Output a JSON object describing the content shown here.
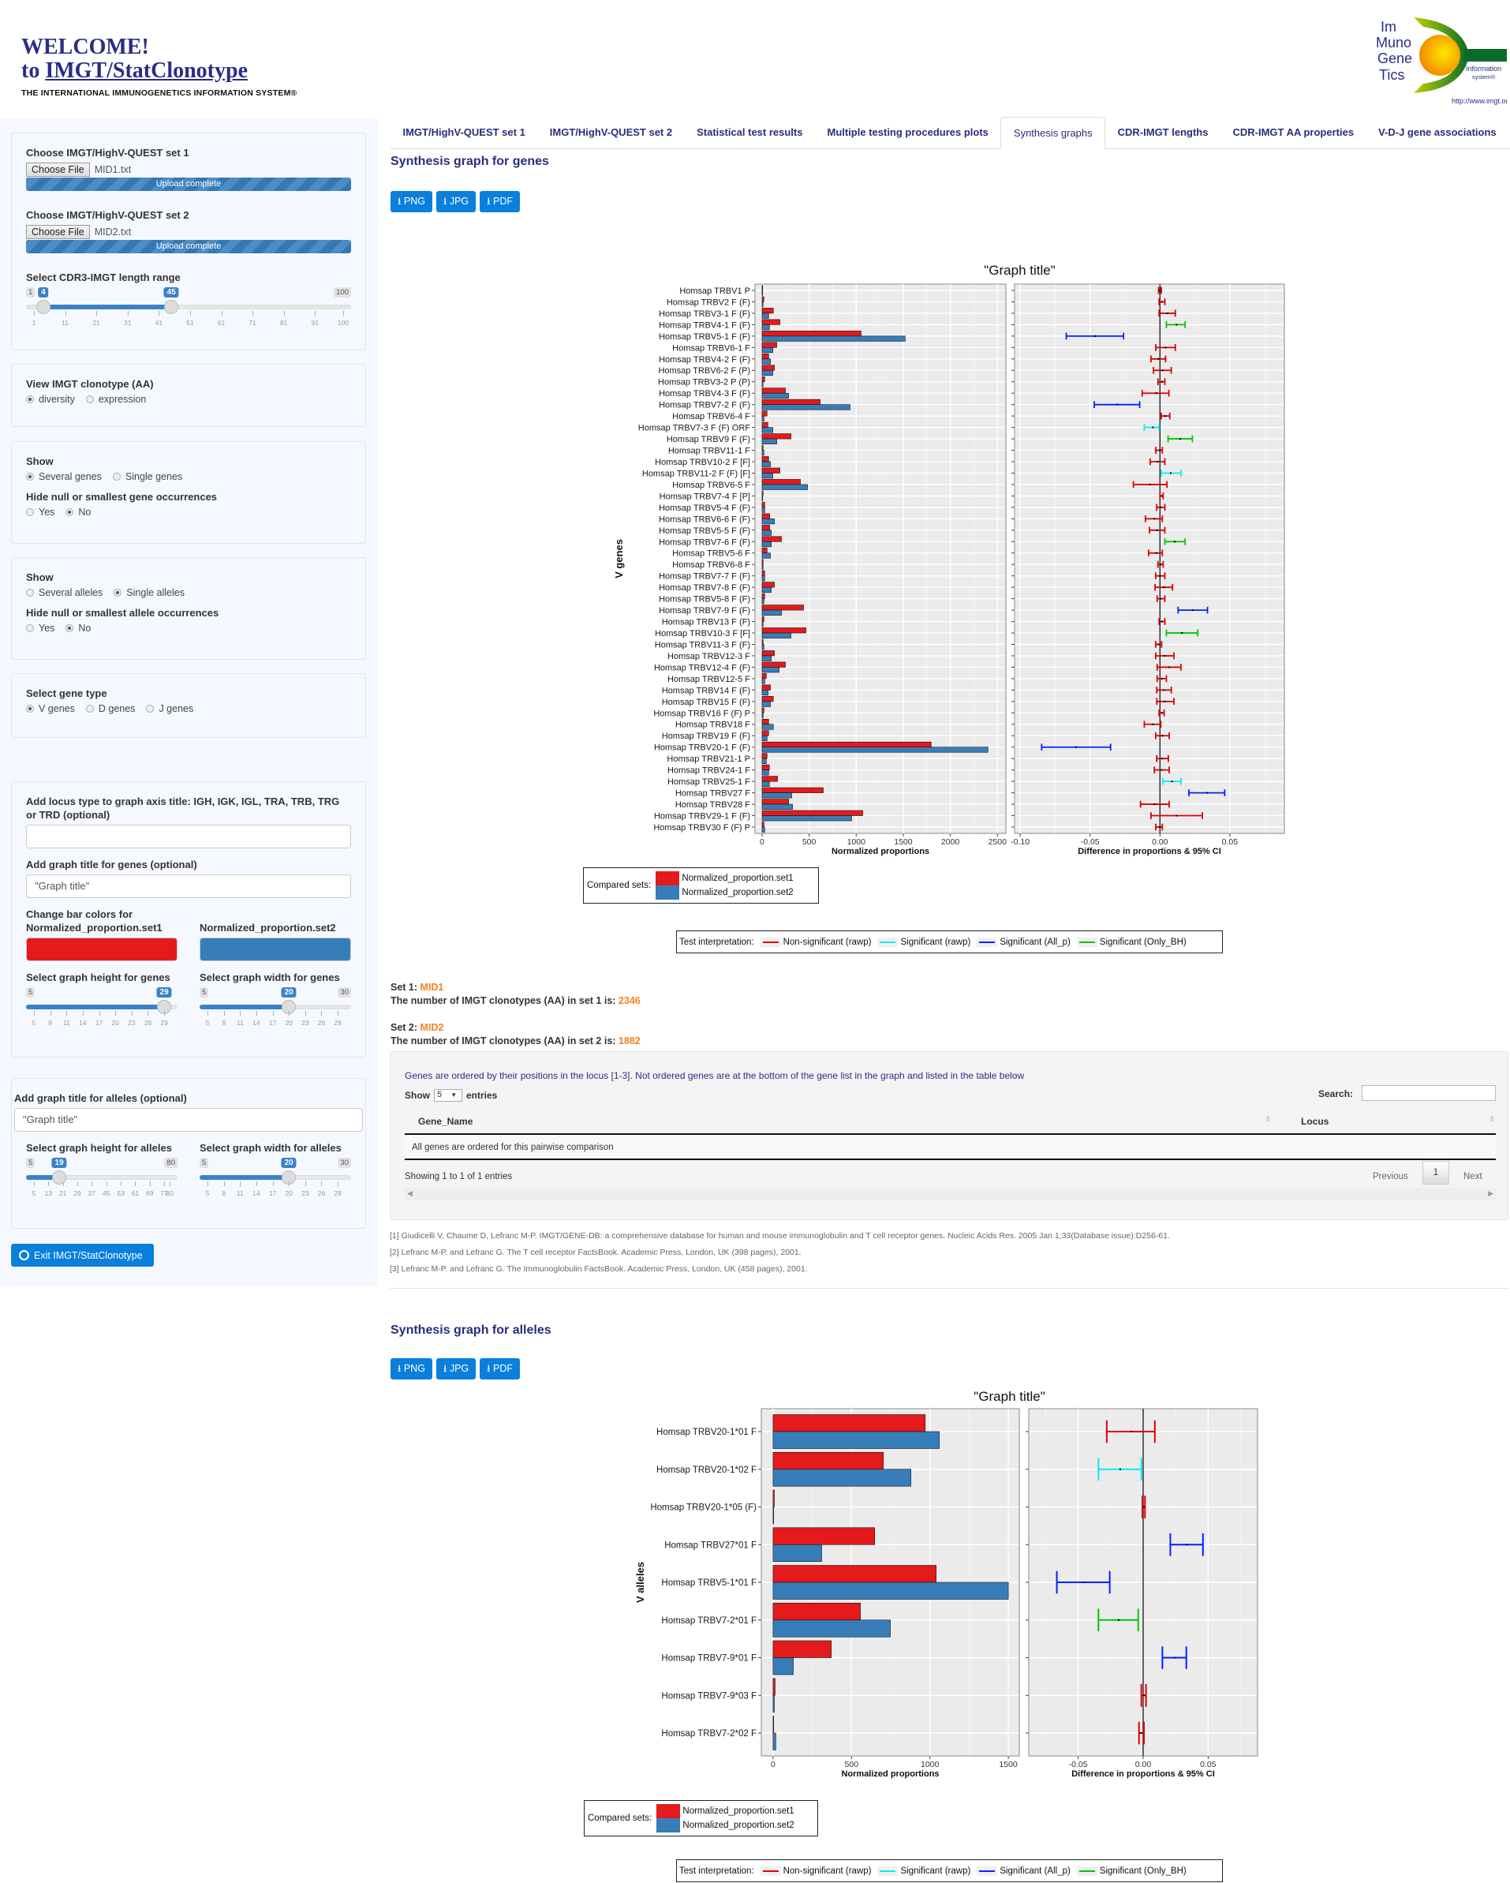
{
  "header": {
    "welcome": "WELCOME!",
    "to": "to",
    "app_link": "IMGT/StatClonotype",
    "subtitle": "THE INTERNATIONAL IMMUNOGENETICS INFORMATION SYSTEM®",
    "logo": {
      "lines": [
        "Im",
        "Muno",
        "Gene",
        "Tics"
      ],
      "info1": "Information",
      "info2": "system®",
      "url": "http://www.imgt.org"
    }
  },
  "sidebar": {
    "set1_label": "Choose IMGT/HighV-QUEST set 1",
    "set1_button": "Choose File",
    "set1_file": "MID1.txt",
    "set1_status": "Upload complete",
    "set2_label": "Choose IMGT/HighV-QUEST set 2",
    "set2_button": "Choose File",
    "set2_file": "MID2.txt",
    "set2_status": "Upload complete",
    "cdr3_label": "Select CDR3-IMGT length range",
    "cdr3_slider": {
      "min": 1,
      "max": 100,
      "from": 4,
      "to": 45,
      "ticks": [
        "1",
        "11",
        "21",
        "31",
        "41",
        "51",
        "61",
        "71",
        "81",
        "91",
        "100"
      ]
    },
    "view_label": "View IMGT clonotype (AA)",
    "view_options": [
      "diversity",
      "expression"
    ],
    "view_selected": 0,
    "show_genes_label": "Show",
    "show_genes_options": [
      "Several genes",
      "Single genes"
    ],
    "show_genes_selected": 0,
    "hide_gene_label": "Hide null or smallest gene occurrences",
    "hide_gene_options": [
      "Yes",
      "No"
    ],
    "hide_gene_selected": 1,
    "show_alleles_label": "Show",
    "show_alleles_options": [
      "Several alleles",
      "Single alleles"
    ],
    "show_alleles_selected": 1,
    "hide_allele_label": "Hide null or smallest allele occurrences",
    "hide_allele_options": [
      "Yes",
      "No"
    ],
    "hide_allele_selected": 1,
    "gene_type_label": "Select gene type",
    "gene_type_options": [
      "V genes",
      "D genes",
      "J genes"
    ],
    "gene_type_selected": 0,
    "locus_label": "Add locus type to graph axis title: IGH, IGK, IGL, TRA, TRB, TRG or TRD (optional)",
    "locus_value": "",
    "gene_title_label": "Add graph title for genes (optional)",
    "gene_title_value": "\"Graph title\"",
    "bar_colors_label": "Change bar colors for",
    "color1_label": "Normalized_proportion.set1",
    "color2_label": "Normalized_proportion.set2",
    "color1": "#e41a1c",
    "color2": "#377eb8",
    "gene_height_label": "Select graph height for genes",
    "gene_height_slider": {
      "min": 5,
      "max": 30,
      "value": 29,
      "ticks": [
        "5",
        "8",
        "11",
        "14",
        "17",
        "20",
        "23",
        "26",
        "29"
      ],
      "show_max": false
    },
    "gene_width_label": "Select graph width for genes",
    "gene_width_slider": {
      "min": 5,
      "max": 30,
      "value": 20,
      "ticks": [
        "5",
        "8",
        "11",
        "14",
        "17",
        "20",
        "23",
        "26",
        "29"
      ],
      "show_max": true
    },
    "allele_title_label": "Add graph title for alleles (optional)",
    "allele_title_value": "\"Graph title\"",
    "allele_height_label": "Select graph height for alleles",
    "allele_height_slider": {
      "min": 5,
      "max": 80,
      "value": 19,
      "ticks": [
        "5",
        "13",
        "21",
        "29",
        "37",
        "45",
        "53",
        "61",
        "69",
        "77",
        "80"
      ],
      "show_max": true
    },
    "allele_width_label": "Select graph width for alleles",
    "allele_width_slider": {
      "min": 5,
      "max": 30,
      "value": 20,
      "ticks": [
        "5",
        "8",
        "11",
        "14",
        "17",
        "20",
        "23",
        "26",
        "29"
      ],
      "show_max": true
    },
    "exit_label": "Exit IMGT/StatClonotype"
  },
  "tabs": [
    {
      "label": "IMGT/HighV-QUEST set 1"
    },
    {
      "label": "IMGT/HighV-QUEST set 2"
    },
    {
      "label": "Statistical test results"
    },
    {
      "label": "Multiple testing procedures plots"
    },
    {
      "label": "Synthesis graphs",
      "active": true
    },
    {
      "label": "CDR-IMGT lengths"
    },
    {
      "label": "CDR-IMGT AA properties"
    },
    {
      "label": "V-D-J gene associations"
    }
  ],
  "genes_section": {
    "title": "Synthesis graph for genes",
    "buttons": [
      "PNG",
      "JPG",
      "PDF"
    ]
  },
  "alleles_section": {
    "title": "Synthesis graph for alleles",
    "buttons": [
      "PNG",
      "JPG",
      "PDF"
    ]
  },
  "legend": {
    "compared_label": "Compared sets:",
    "sets": [
      "Normalized_proportion.set1",
      "Normalized_proportion.set2"
    ],
    "test_label": "Test interpretation:",
    "tests": [
      "Non-significant (rawp)",
      "Significant (rawp)",
      "Significant (All_p)",
      "Significant (Only_BH)"
    ],
    "test_colors": [
      "#e00000",
      "#00f0f0",
      "#0022ff",
      "#00c800"
    ]
  },
  "set_info": {
    "set1_prefix": "Set 1:",
    "set1_name": "MID1",
    "set1_count_text": "The number of IMGT clonotypes (AA) in set 1 is:",
    "set1_count": "2346",
    "set2_prefix": "Set 2:",
    "set2_name": "MID2",
    "set2_count_text": "The number of IMGT clonotypes (AA) in set 2 is:",
    "set2_count": "1882"
  },
  "table": {
    "note": "Genes are ordered by their positions in the locus [1-3]. Not ordered genes are at the bottom of the gene list in the graph and listed in the table below",
    "show": "Show",
    "entries_value": "5",
    "entries": "entries",
    "search_label": "Search:",
    "search_value": "",
    "columns": [
      "Gene_Name",
      "Locus"
    ],
    "empty_row": "All genes are ordered for this pairwise comparison",
    "info": "Showing 1 to 1 of 1 entries",
    "previous": "Previous",
    "page": "1",
    "next": "Next"
  },
  "references": [
    "[1] Giudicelli V, Chaume D, Lefranc M-P. IMGT/GENE-DB: a comprehensive database for human and mouse immunoglobulin and T cell receptor genes. Nucleic Acids Res. 2005 Jan 1;33(Database issue):D256-61.",
    "[2] Lefranc M-P. and Lefranc G. The T cell receptor FactsBook. Academic Press, London, UK (398 pages), 2001.",
    "[3] Lefranc M-P. and Lefranc G. The Immunoglobulin FactsBook. Academic Press, London, UK (458 pages), 2001."
  ],
  "chart_data": [
    {
      "type": "bar",
      "title": "\"Graph title\"",
      "ylabel": "V genes",
      "xlabel": "Normalized proportions",
      "xlabel_diff": "Difference in proportions & 95% CI",
      "xlim": [
        -75,
        2590
      ],
      "xticks": [
        0,
        500,
        1000,
        1500,
        2000,
        2500
      ],
      "xlim_diff": [
        -0.104,
        0.089
      ],
      "xticks_diff": [
        "-0.10",
        "-0.05",
        "0.00",
        "0.05"
      ],
      "grid": true,
      "categories": [
        "Homsap TRBV1 P",
        "Homsap TRBV2 F (F)",
        "Homsap TRBV3-1 F (F)",
        "Homsap TRBV4-1 F (F)",
        "Homsap TRBV5-1 F (F)",
        "Homsap TRBV6-1 F",
        "Homsap TRBV4-2 F (F)",
        "Homsap TRBV6-2 F (P)",
        "Homsap TRBV3-2 P (P)",
        "Homsap TRBV4-3 F (F)",
        "Homsap TRBV7-2 F (F)",
        "Homsap TRBV6-4 F",
        "Homsap TRBV7-3 F (F) ORF",
        "Homsap TRBV9 F (F)",
        "Homsap TRBV11-1 F",
        "Homsap TRBV10-2 F [F]",
        "Homsap TRBV11-2 F (F) [F]",
        "Homsap TRBV6-5 F",
        "Homsap TRBV7-4 F [P]",
        "Homsap TRBV5-4 F (F)",
        "Homsap TRBV6-6 F (F)",
        "Homsap TRBV5-5 F (F)",
        "Homsap TRBV7-6 F (F)",
        "Homsap TRBV5-6 F",
        "Homsap TRBV6-8 F",
        "Homsap TRBV7-7 F (F)",
        "Homsap TRBV7-8 F (F)",
        "Homsap TRBV5-8 F (F)",
        "Homsap TRBV7-9 F (F)",
        "Homsap TRBV13 F (F)",
        "Homsap TRBV10-3 F [F]",
        "Homsap TRBV11-3 F (F)",
        "Homsap TRBV12-3 F",
        "Homsap TRBV12-4 F (F)",
        "Homsap TRBV12-5 F",
        "Homsap TRBV14 F (F)",
        "Homsap TRBV15 F (F)",
        "Homsap TRBV16 F (F) P",
        "Homsap TRBV18 F",
        "Homsap TRBV19 F (F)",
        "Homsap TRBV20-1 F (F)",
        "Homsap TRBV21-1 P",
        "Homsap TRBV24-1 F",
        "Homsap TRBV25-1 F",
        "Homsap TRBV27 F",
        "Homsap TRBV28 F",
        "Homsap TRBV29-1 F (F)",
        "Homsap TRBV30 F (F) P"
      ],
      "series": [
        {
          "name": "Normalized_proportion.set1",
          "color": "#e41a1c",
          "values": [
            2,
            20,
            120,
            190,
            1052,
            156,
            70,
            131,
            28,
            248,
            617,
            53,
            61,
            307,
            11,
            70,
            190,
            407,
            11,
            28,
            81,
            81,
            206,
            53,
            11,
            28,
            131,
            28,
            441,
            20,
            466,
            11,
            131,
            248,
            45,
            89,
            120,
            20,
            70,
            70,
            1797,
            53,
            78,
            165,
            650,
            282,
            1069,
            20
          ]
        },
        {
          "name": "Normalized_proportion.set2",
          "color": "#377eb8",
          "values": [
            5,
            10,
            70,
            78,
            1520,
            114,
            89,
            114,
            11,
            282,
            935,
            20,
            114,
            156,
            20,
            89,
            114,
            483,
            5,
            28,
            131,
            98,
            98,
            89,
            11,
            28,
            98,
            20,
            206,
            11,
            307,
            20,
            98,
            181,
            28,
            64,
            89,
            11,
            120,
            53,
            2400,
            45,
            70,
            78,
            315,
            324,
            951,
            28
          ]
        }
      ],
      "difference": [
        [
          -0.001,
          0,
          0.001
        ],
        [
          -0.0006,
          0.0014,
          0.0035
        ],
        [
          -0.0006,
          0.0054,
          0.011
        ],
        [
          0.0046,
          0.0118,
          0.018
        ],
        [
          -0.067,
          -0.0464,
          -0.026
        ],
        [
          -0.003,
          0.004,
          0.011
        ],
        [
          -0.0064,
          -0.001,
          0.004
        ],
        [
          -0.0046,
          0.0017,
          0.0081
        ],
        [
          -0.0014,
          0.0014,
          0.0035
        ],
        [
          -0.0127,
          -0.0027,
          0.0064
        ],
        [
          -0.047,
          -0.0305,
          -0.0145
        ],
        [
          0.001,
          0.0037,
          0.007
        ],
        [
          -0.0112,
          -0.005,
          -0.0006
        ],
        [
          0.0058,
          0.0145,
          0.0232
        ],
        [
          -0.003,
          0,
          0.0017
        ],
        [
          -0.007,
          -0.0015,
          0.0035
        ],
        [
          0.001,
          0.0077,
          0.015
        ],
        [
          -0.019,
          -0.007,
          0.005
        ],
        [
          0,
          0.0012,
          0.0023
        ],
        [
          -0.0023,
          0.0006,
          0.0035
        ],
        [
          -0.0104,
          -0.0039,
          0.0017
        ],
        [
          -0.0075,
          -0.002,
          0.0035
        ],
        [
          0.0035,
          0.0106,
          0.018
        ],
        [
          -0.0081,
          -0.0027,
          0.0017
        ],
        [
          -0.0014,
          0.0006,
          0.0023
        ],
        [
          -0.003,
          0,
          0.0035
        ],
        [
          -0.0035,
          0.003,
          0.009
        ],
        [
          -0.002,
          0.0006,
          0.0035
        ],
        [
          0.013,
          0.0234,
          0.034
        ],
        [
          -0.0006,
          0.0014,
          0.0035
        ],
        [
          0.0046,
          0.0158,
          0.027
        ],
        [
          -0.003,
          -0.001,
          0.0012
        ],
        [
          -0.003,
          0.0035,
          0.01
        ],
        [
          -0.002,
          0.0066,
          0.015
        ],
        [
          -0.002,
          0.0014,
          0.0046
        ],
        [
          -0.0023,
          0.003,
          0.0081
        ],
        [
          -0.0023,
          0.0035,
          0.01
        ],
        [
          -0.0006,
          0.0014,
          0.003
        ],
        [
          -0.0112,
          -0.005,
          0.0006
        ],
        [
          -0.003,
          0.0017,
          0.0066
        ],
        [
          -0.0846,
          -0.06,
          -0.0353
        ],
        [
          -0.0023,
          0.0017,
          0.006
        ],
        [
          -0.004,
          0.0012,
          0.0066
        ],
        [
          0.002,
          0.0087,
          0.015
        ],
        [
          0.0207,
          0.0338,
          0.0463
        ],
        [
          -0.0139,
          -0.0039,
          0.0066
        ],
        [
          -0.0064,
          0.0118,
          0.0303
        ],
        [
          -0.003,
          0,
          0.0017
        ]
      ],
      "interpretation": [
        0,
        0,
        0,
        3,
        2,
        0,
        0,
        0,
        0,
        0,
        2,
        0,
        1,
        3,
        0,
        0,
        1,
        0,
        0,
        0,
        0,
        0,
        3,
        0,
        0,
        0,
        0,
        0,
        2,
        0,
        3,
        0,
        0,
        0,
        0,
        0,
        0,
        0,
        0,
        0,
        2,
        0,
        0,
        1,
        2,
        0,
        0,
        0
      ]
    },
    {
      "type": "bar",
      "title": "\"Graph title\"",
      "ylabel": "V alleles",
      "xlabel": "Normalized proportions",
      "xlabel_diff": "Difference in proportions & 95% CI",
      "xlim": [
        -75,
        1570
      ],
      "xticks": [
        0,
        500,
        1000,
        1500
      ],
      "xlim_diff": [
        -0.088,
        0.088
      ],
      "xticks_diff": [
        "-0.05",
        "0.00",
        "0.05"
      ],
      "grid": true,
      "categories": [
        "Homsap TRBV20-1*01 F",
        "Homsap TRBV20-1*02 F",
        "Homsap TRBV20-1*05 (F)",
        "Homsap TRBV27*01 F",
        "Homsap TRBV5-1*01 F",
        "Homsap TRBV7-2*01 F",
        "Homsap TRBV7-9*01 F",
        "Homsap TRBV7-9*03 F",
        "Homsap TRBV7-2*02 F"
      ],
      "series": [
        {
          "name": "Normalized_proportion.set1",
          "color": "#e41a1c",
          "values": [
            970,
            703,
            8,
            648,
            1040,
            557,
            371,
            13,
            3
          ]
        },
        {
          "name": "Normalized_proportion.set2",
          "color": "#377eb8",
          "values": [
            1060,
            879,
            3,
            310,
            1500,
            748,
            129,
            8,
            17
          ]
        }
      ],
      "difference": [
        [
          -0.028,
          -0.009,
          0.009
        ],
        [
          -0.0344,
          -0.0176,
          -0.0014
        ],
        [
          -0.0006,
          0.0006,
          0.0014
        ],
        [
          0.0209,
          0.0334,
          0.046
        ],
        [
          -0.0664,
          -0.0455,
          -0.0257
        ],
        [
          -0.0344,
          -0.0188,
          -0.0038
        ],
        [
          0.0148,
          0.0243,
          0.0332
        ],
        [
          -0.0014,
          0.0006,
          0.0022
        ],
        [
          -0.0032,
          -0.0014,
          0.0006
        ]
      ],
      "interpretation": [
        0,
        1,
        0,
        2,
        2,
        3,
        2,
        0,
        0
      ]
    }
  ]
}
